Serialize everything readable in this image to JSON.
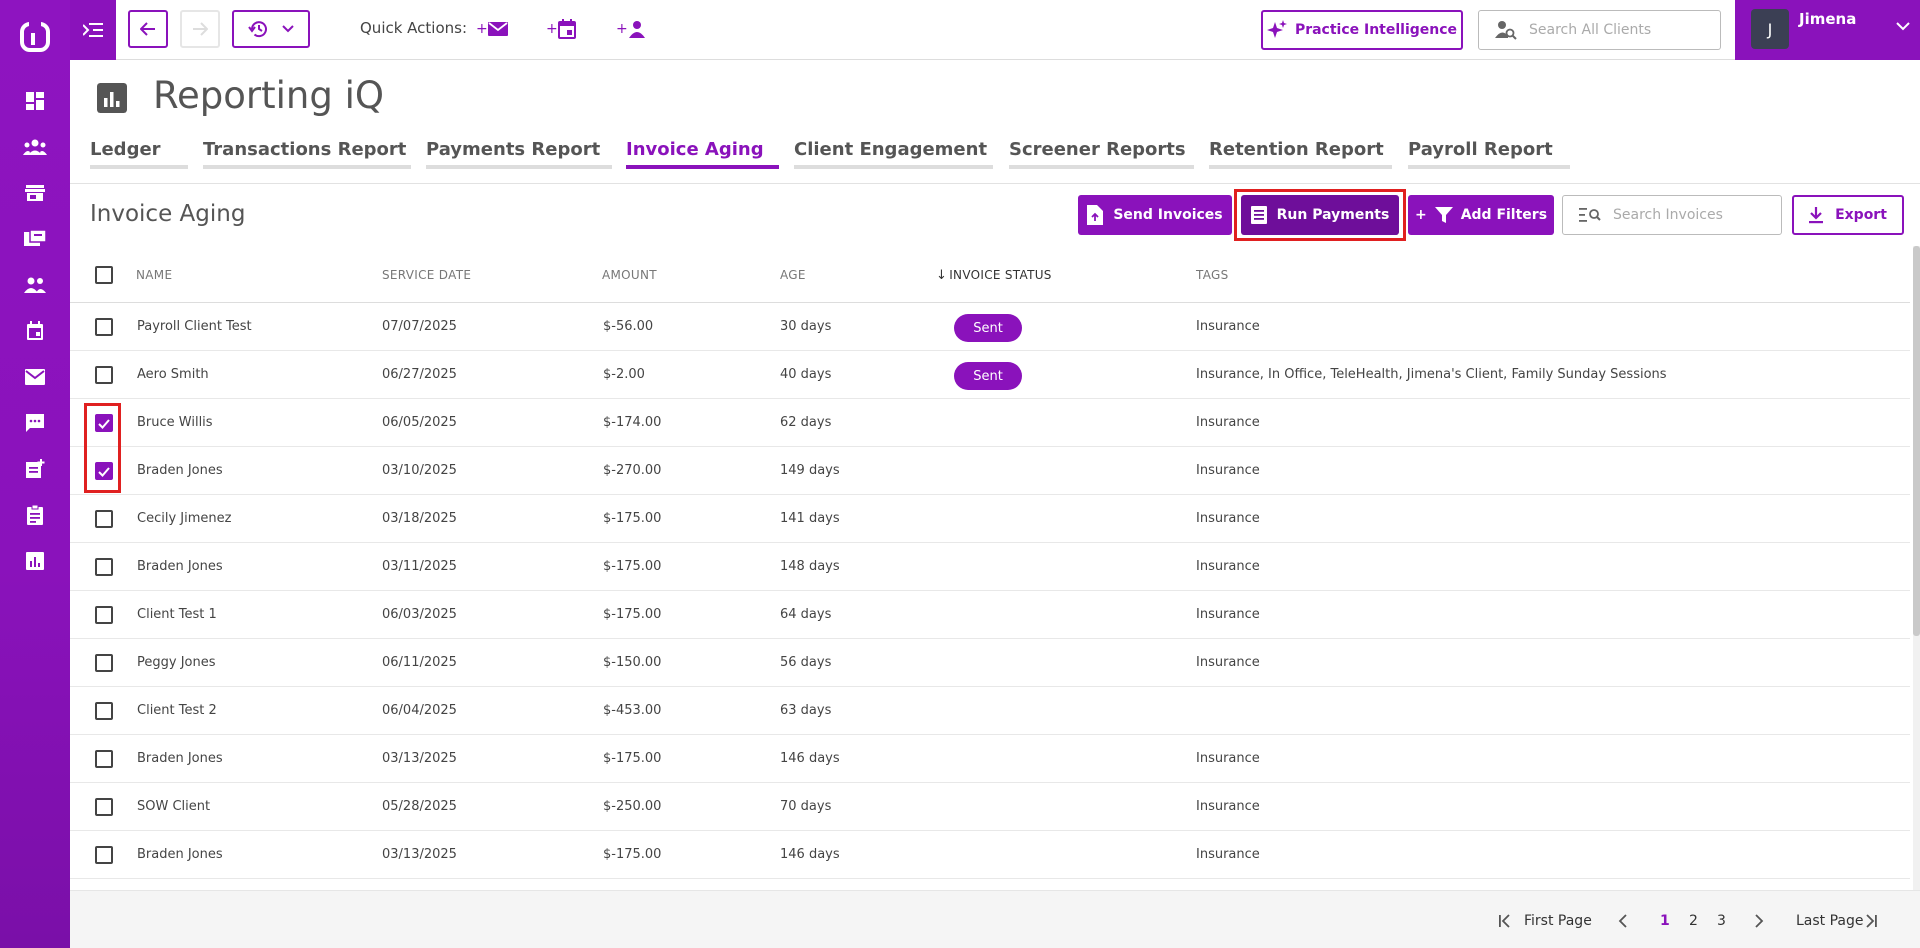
{
  "topbar": {
    "quick_actions_label": "Quick Actions:",
    "quick_actions": [
      {
        "prefix": "+",
        "icon": "mail-icon"
      },
      {
        "prefix": "+",
        "icon": "calendar-icon"
      },
      {
        "prefix": "+",
        "icon": "person-icon"
      }
    ],
    "practice_intelligence_label": "Practice Intelligence",
    "client_search_placeholder": "Search All Clients",
    "user_name": "Jimena",
    "user_initial": "J"
  },
  "page": {
    "title": "Reporting iQ",
    "tabs": [
      {
        "label": "Ledger",
        "active": false
      },
      {
        "label": "Transactions Report",
        "active": false
      },
      {
        "label": "Payments Report",
        "active": false
      },
      {
        "label": "Invoice Aging",
        "active": true
      },
      {
        "label": "Client Engagement",
        "active": false
      },
      {
        "label": "Screener Reports",
        "active": false
      },
      {
        "label": "Retention Report",
        "active": false
      },
      {
        "label": "Payroll Report",
        "active": false
      }
    ]
  },
  "toolbar": {
    "section_title": "Invoice Aging",
    "send_invoices_label": "Send Invoices",
    "run_payments_label": "Run Payments",
    "add_filters_label": "Add Filters",
    "add_filters_prefix": "+",
    "search_placeholder": "Search Invoices",
    "export_label": "Export"
  },
  "table": {
    "columns": [
      "NAME",
      "SERVICE DATE",
      "AMOUNT",
      "AGE",
      "INVOICE STATUS",
      "TAGS"
    ],
    "sort_arrow": "↓",
    "rows": [
      {
        "name": "Payroll Client Test",
        "date": "07/07/2025",
        "amount": "$-56.00",
        "age": "30 days",
        "status": "Sent",
        "tags": "Insurance",
        "checked": false
      },
      {
        "name": "Aero Smith",
        "date": "06/27/2025",
        "amount": "$-2.00",
        "age": "40 days",
        "status": "Sent",
        "tags": "Insurance, In Office, TeleHealth, Jimena's Client, Family Sunday Sessions",
        "checked": false
      },
      {
        "name": "Bruce Willis",
        "date": "06/05/2025",
        "amount": "$-174.00",
        "age": "62 days",
        "status": "",
        "tags": "Insurance",
        "checked": true
      },
      {
        "name": "Braden Jones",
        "date": "03/10/2025",
        "amount": "$-270.00",
        "age": "149 days",
        "status": "",
        "tags": "Insurance",
        "checked": true
      },
      {
        "name": "Cecily Jimenez",
        "date": "03/18/2025",
        "amount": "$-175.00",
        "age": "141 days",
        "status": "",
        "tags": "Insurance",
        "checked": false
      },
      {
        "name": "Braden Jones",
        "date": "03/11/2025",
        "amount": "$-175.00",
        "age": "148 days",
        "status": "",
        "tags": "Insurance",
        "checked": false
      },
      {
        "name": "Client Test 1",
        "date": "06/03/2025",
        "amount": "$-175.00",
        "age": "64 days",
        "status": "",
        "tags": "Insurance",
        "checked": false
      },
      {
        "name": "Peggy Jones",
        "date": "06/11/2025",
        "amount": "$-150.00",
        "age": "56 days",
        "status": "",
        "tags": "Insurance",
        "checked": false
      },
      {
        "name": "Client Test 2",
        "date": "06/04/2025",
        "amount": "$-453.00",
        "age": "63 days",
        "status": "",
        "tags": "",
        "checked": false
      },
      {
        "name": "Braden Jones",
        "date": "03/13/2025",
        "amount": "$-175.00",
        "age": "146 days",
        "status": "",
        "tags": "Insurance",
        "checked": false
      },
      {
        "name": "SOW Client",
        "date": "05/28/2025",
        "amount": "$-250.00",
        "age": "70 days",
        "status": "",
        "tags": "Insurance",
        "checked": false
      },
      {
        "name": "Braden Jones",
        "date": "03/13/2025",
        "amount": "$-175.00",
        "age": "146 days",
        "status": "",
        "tags": "Insurance",
        "checked": false
      }
    ]
  },
  "pagination": {
    "first_label": "First Page",
    "last_label": "Last Page",
    "pages": [
      "1",
      "2",
      "3"
    ],
    "current": "1"
  },
  "colors": {
    "brand_purple": "#8a12bb",
    "highlight_red": "#e02020"
  }
}
